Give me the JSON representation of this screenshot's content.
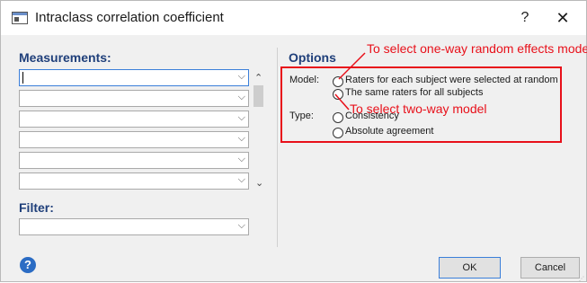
{
  "window": {
    "title": "Intraclass correlation coefficient",
    "help_glyph": "?",
    "close_glyph": "✕",
    "app_icon": "window-icon"
  },
  "measurements": {
    "label": "Measurements:",
    "fields": [
      "",
      "",
      "",
      "",
      "",
      ""
    ],
    "scroll_up": "⌃",
    "scroll_down": "⌄"
  },
  "filter": {
    "label": "Filter:",
    "value": ""
  },
  "options": {
    "title": "Options",
    "model_label": "Model:",
    "model_options": [
      {
        "label": "Raters for each subject were selected at random",
        "selected": false
      },
      {
        "label": "The same raters for all subjects",
        "selected": false
      }
    ],
    "type_label": "Type:",
    "type_options": [
      {
        "label": "Consistency",
        "selected": false
      },
      {
        "label": "Absolute agreement",
        "selected": false
      }
    ]
  },
  "annotations": {
    "one_way": "To select one-way random effects model",
    "two_way": "To select two-way model",
    "color": "#e8101a"
  },
  "footer": {
    "help_glyph": "?",
    "ok_label": "OK",
    "cancel_label": "Cancel"
  },
  "chevron_glyph": "⌵"
}
